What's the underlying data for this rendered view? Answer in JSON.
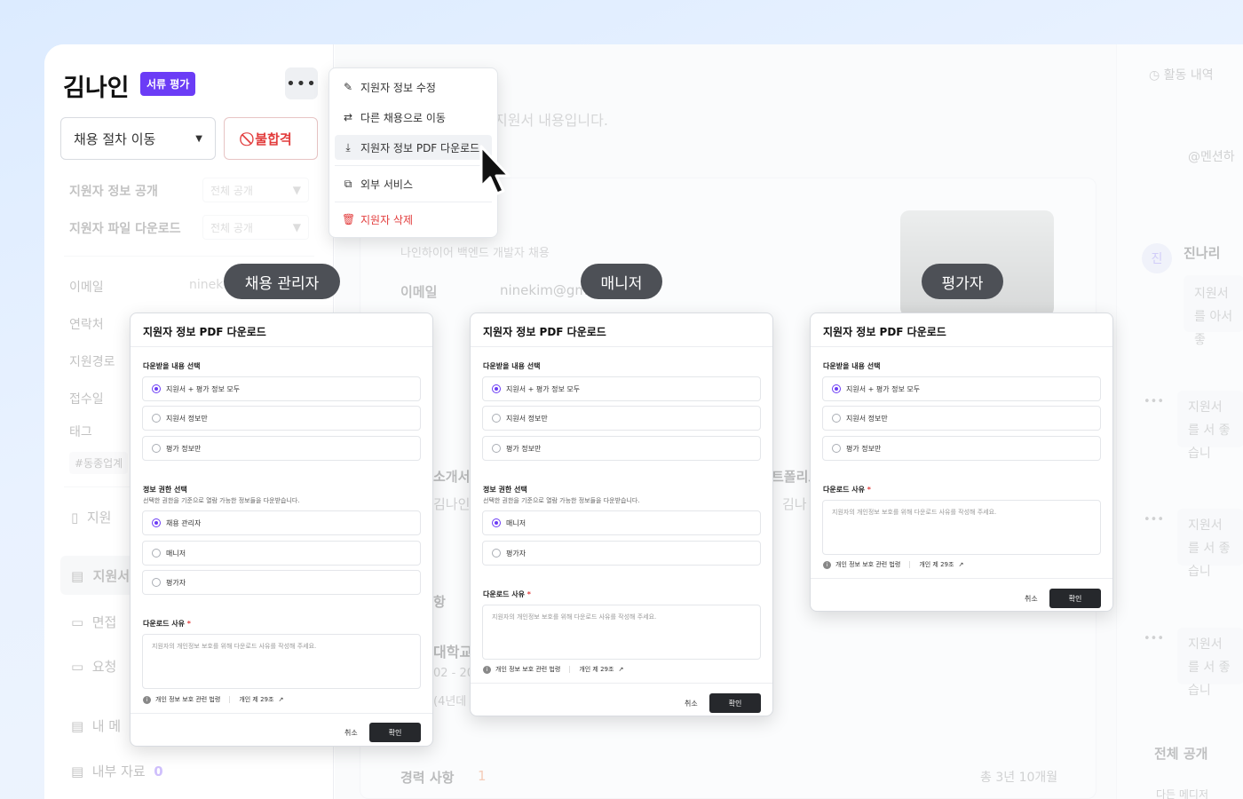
{
  "left": {
    "candidate_name": "김나인",
    "stage_badge": "서류 평가",
    "move_stage": "채용 절차 이동",
    "reject": "불합격",
    "info_public_label": "지원자 정보 공개",
    "info_public_value": "전체 공개",
    "file_download_label": "지원자 파일 다운로드",
    "file_download_value": "전체 공개",
    "fields": [
      "이메일",
      "연락처",
      "지원경로",
      "접수일",
      "태그"
    ],
    "email_partial": "ninek",
    "tag": "#동종업계",
    "nav": [
      "지원",
      "지원서",
      "면접",
      "요청",
      "내 메",
      "내부 자료"
    ],
    "internal_count": "0"
  },
  "menu": {
    "items": [
      {
        "icon": "pencil-icon",
        "label": "지원자 정보 수정"
      },
      {
        "icon": "swap-icon",
        "label": "다른 채용으로 이동"
      },
      {
        "icon": "download-icon",
        "label": "지원자 정보 PDF 다운로드"
      },
      {
        "icon": "external-service-icon",
        "label": "외부 서비스"
      },
      {
        "icon": "trash-icon",
        "label": "지원자 삭제"
      }
    ]
  },
  "main": {
    "hint": "지원서 내용입니다.",
    "job_title": "나인하이어 백엔드 개발자 채용",
    "email_label": "이메일",
    "email_value": "ninekim@gm",
    "section_intro": "소개서",
    "section_portfolio": "트폴리오",
    "intro_name": "김나인",
    "portfolio_name": "김나",
    "section_hak": "항",
    "school": "대학교",
    "school_dates": "02 - 20",
    "school_note": "(4년데",
    "career_label": "경력 사항",
    "career_count": "1",
    "career_total": "총 3년 10개월"
  },
  "right": {
    "activity": "활동 내역",
    "mention": "@멘션하",
    "reviewer_initial": "진",
    "reviewer_name": "진나리",
    "comment1": "지원서를 아서 좋",
    "comment2": "지원서를 서 좋습니",
    "comment3": "지원서를 서 좋습니",
    "comment4": "지원서를 서 좋습니",
    "visibility": "전체 공개",
    "bottom_partial": "다든 메디저"
  },
  "roles": {
    "recruit_admin": "채용 관리자",
    "manager": "매니저",
    "evaluator": "평가자"
  },
  "dialog": {
    "title": "지원자 정보 PDF 다운로드",
    "content_label": "다운받을 내용 선택",
    "content_options": [
      "지원서 + 평가 정보 모두",
      "지원서 정보만",
      "평가 정보만"
    ],
    "perm_label": "정보 권한 선택",
    "perm_help": "선택한 권한을 기준으로 열람 가능한 정보들을 다운받습니다.",
    "perm_options_admin": [
      "채용 관리자",
      "매니저",
      "평가자"
    ],
    "perm_options_manager": [
      "매니저",
      "평가자"
    ],
    "reason_label": "다운로드 사유",
    "required_mark": "*",
    "reason_placeholder": "지원자의 개인정보 보호를 위해 다운로드 사유를 작성해 주세요.",
    "law_label": "개인 정보 보호 관련 법령",
    "law_article": "개인 제 29조",
    "cancel": "취소",
    "confirm": "확인"
  },
  "colors": {
    "accent": "#6b3cf6",
    "danger": "#e23c3c",
    "confirm_button": "#26282c",
    "role_pill": "#4d5056"
  }
}
